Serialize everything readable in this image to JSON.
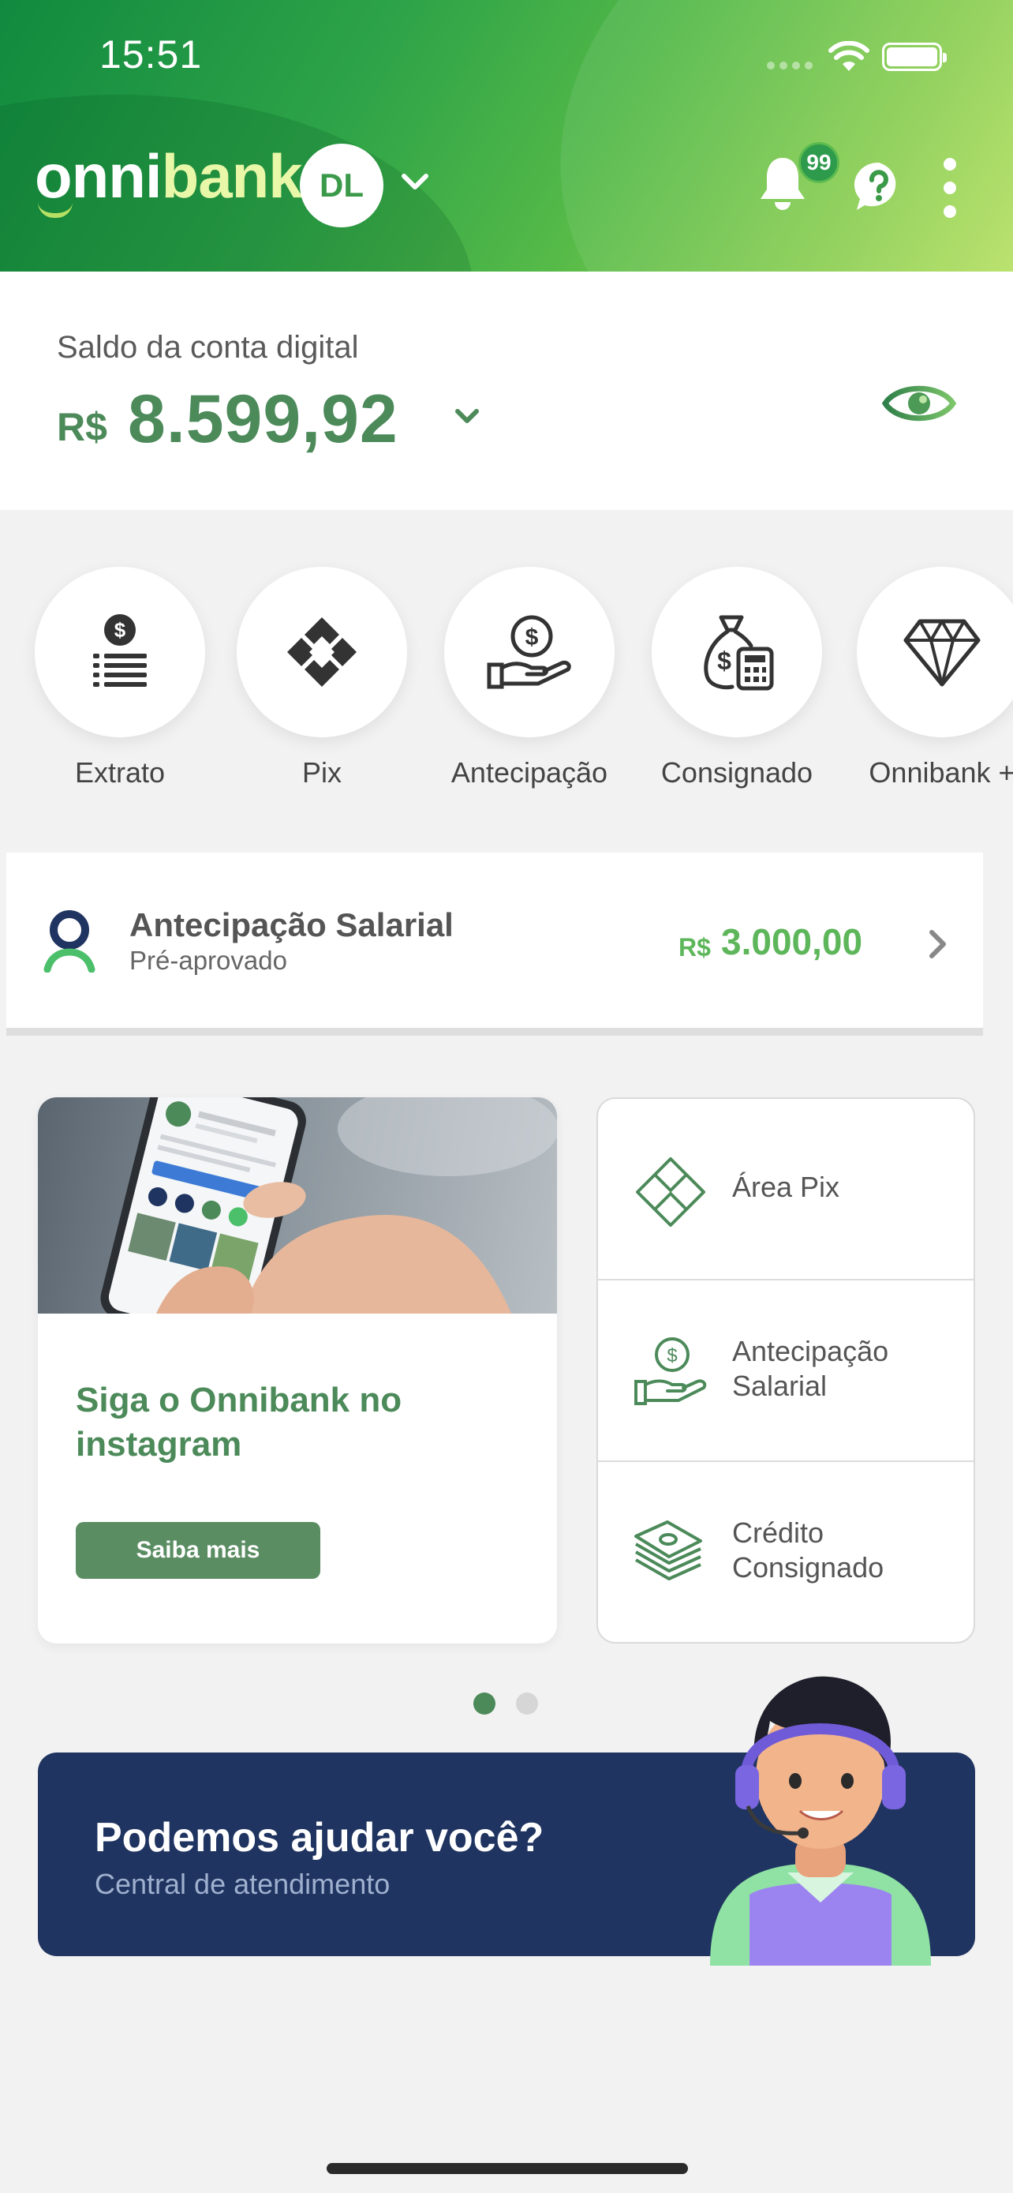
{
  "status_bar": {
    "time": "15:51"
  },
  "header": {
    "logo_part1": "onni",
    "logo_part2": "bank",
    "avatar_initials": "DL",
    "notification_count": "99"
  },
  "balance": {
    "label": "Saldo da conta digital",
    "currency": "R$",
    "value": "8.599,92"
  },
  "quick_actions": [
    {
      "label": "Extrato",
      "icon": "statement-icon"
    },
    {
      "label": "Pix",
      "icon": "pix-icon"
    },
    {
      "label": "Antecipação",
      "icon": "hand-coin-icon"
    },
    {
      "label": "Consignado",
      "icon": "money-bag-calculator-icon"
    },
    {
      "label": "Onnibank +",
      "icon": "diamond-icon"
    }
  ],
  "salary_advance": {
    "title": "Antecipação Salarial",
    "subtitle": "Pré-aprovado",
    "currency": "R$",
    "amount": "3.000,00"
  },
  "instagram_card": {
    "title": "Siga o Onnibank no instagram",
    "button": "Saiba mais"
  },
  "shortcuts": [
    {
      "label": "Área Pix",
      "icon": "pix-outline-icon"
    },
    {
      "label": "Antecipação Salarial",
      "icon": "hand-coin-outline-icon"
    },
    {
      "label": "Crédito Consignado",
      "icon": "cash-stack-icon"
    }
  ],
  "pager": {
    "count": 2,
    "active": 0
  },
  "help_banner": {
    "title": "Podemos ajudar você?",
    "subtitle": "Central de atendimento"
  },
  "colors": {
    "brand_green": "#4c8a5a",
    "accent_green": "#5db65a",
    "banner_navy": "#1f3460"
  }
}
